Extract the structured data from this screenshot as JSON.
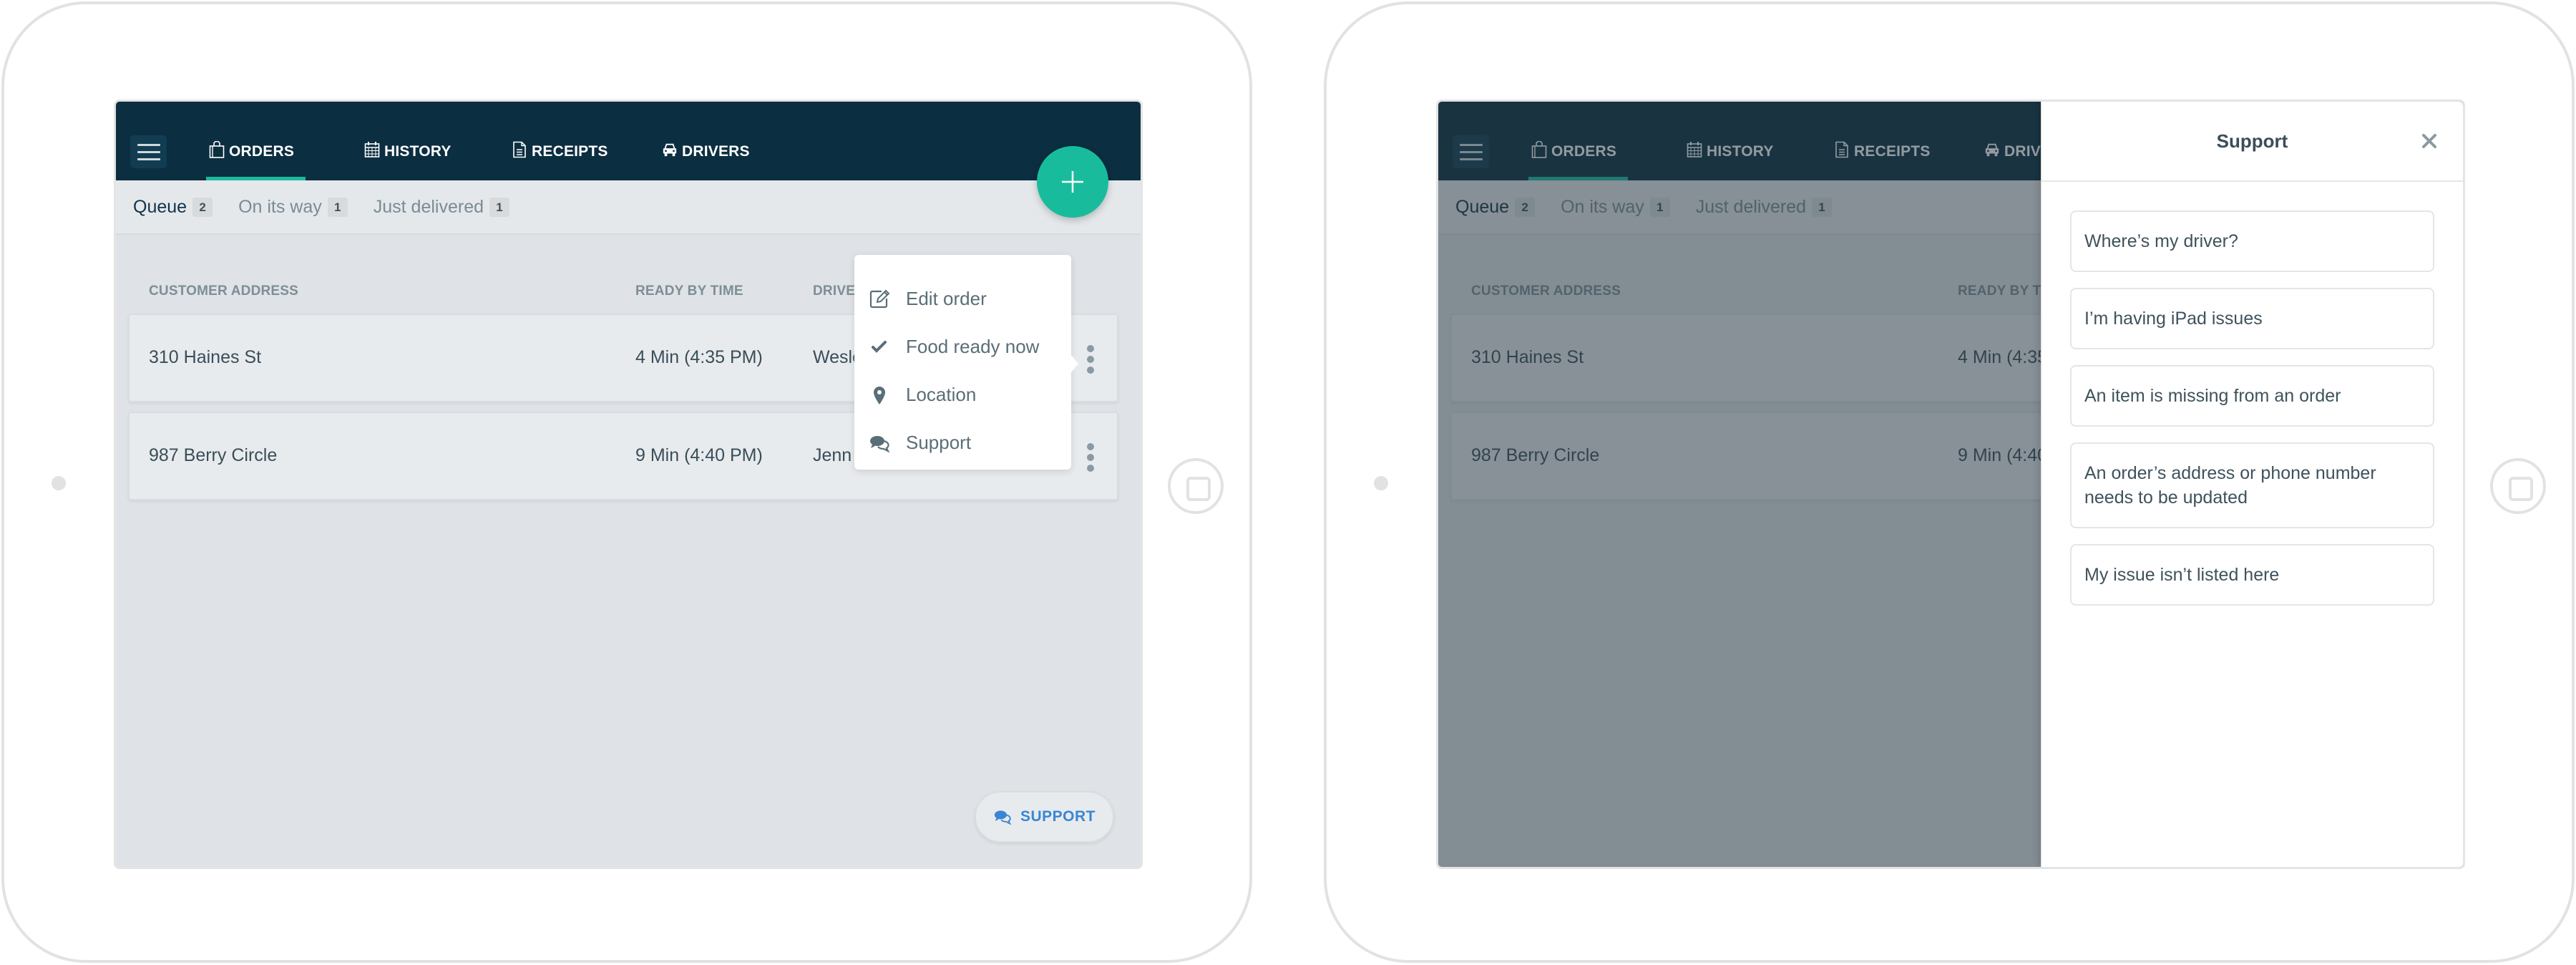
{
  "nav": {
    "tabs": [
      {
        "label": "ORDERS",
        "icon": "shopping-bag-icon",
        "active": true
      },
      {
        "label": "HISTORY",
        "icon": "calendar-icon",
        "active": false
      },
      {
        "label": "RECEIPTS",
        "icon": "document-icon",
        "active": false
      },
      {
        "label": "DRIVERS",
        "icon": "car-icon",
        "active": false
      }
    ],
    "menu_icon": "hamburger-icon",
    "add_icon": "plus-icon"
  },
  "subtabs": [
    {
      "label": "Queue",
      "count": "2",
      "active": true
    },
    {
      "label": "On its way",
      "count": "1",
      "active": false
    },
    {
      "label": "Just delivered",
      "count": "1",
      "active": false
    }
  ],
  "table": {
    "headers": {
      "address": "CUSTOMER ADDRESS",
      "ready_by": "READY BY TIME",
      "driver": "DRIVER"
    },
    "rows": [
      {
        "address": "310 Haines St",
        "ready_by": "4 Min (4:35 PM)",
        "driver": "Wesley"
      },
      {
        "address": "987 Berry Circle",
        "ready_by": "9 Min (4:40 PM)",
        "driver": "Jenn"
      }
    ]
  },
  "context_menu": {
    "items": [
      {
        "label": "Edit order",
        "icon": "edit-icon"
      },
      {
        "label": "Food ready now",
        "icon": "check-icon"
      },
      {
        "label": "Location",
        "icon": "map-pin-icon"
      },
      {
        "label": "Support",
        "icon": "chat-bubbles-icon"
      }
    ]
  },
  "support_button": {
    "label": "SUPPORT",
    "icon": "chat-bubbles-icon"
  },
  "support_panel": {
    "title": "Support",
    "close_icon": "close-icon",
    "options": [
      "Where’s my driver?",
      "I’m having iPad issues",
      "An item is missing from an order",
      "An order’s address or phone number needs to be updated",
      "My issue isn’t listed here"
    ]
  },
  "colors": {
    "navbar": "#0b2e41",
    "accent": "#18bc9c",
    "link_blue": "#3a86d4",
    "background": "#dfe2e6"
  }
}
